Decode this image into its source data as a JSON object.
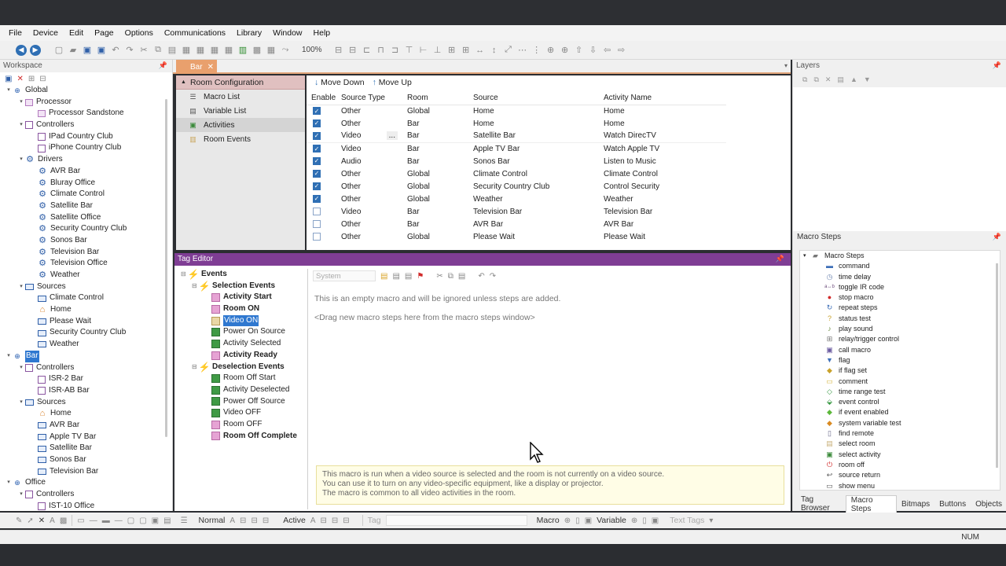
{
  "menu": [
    "File",
    "Device",
    "Edit",
    "Page",
    "Options",
    "Communications",
    "Library",
    "Window",
    "Help"
  ],
  "toolbar": {
    "zoom": "100%"
  },
  "workspace": {
    "title": "Workspace",
    "tree": [
      {
        "lvl": 0,
        "tog": "▾",
        "icon": "globe",
        "label": "Global"
      },
      {
        "lvl": 1,
        "tog": "▾",
        "icon": "proc",
        "label": "Processor"
      },
      {
        "lvl": 2,
        "tog": "",
        "icon": "proc",
        "label": "Processor Sandstone"
      },
      {
        "lvl": 1,
        "tog": "▾",
        "icon": "ctrl",
        "label": "Controllers"
      },
      {
        "lvl": 2,
        "tog": "",
        "icon": "ctrl",
        "label": "IPad Country Club"
      },
      {
        "lvl": 2,
        "tog": "",
        "icon": "ctrl",
        "label": "iPhone Country Club"
      },
      {
        "lvl": 1,
        "tog": "▾",
        "icon": "gear",
        "label": "Drivers"
      },
      {
        "lvl": 2,
        "tog": "",
        "icon": "gear",
        "label": "AVR Bar"
      },
      {
        "lvl": 2,
        "tog": "",
        "icon": "gear",
        "label": "Bluray Office"
      },
      {
        "lvl": 2,
        "tog": "",
        "icon": "gear",
        "label": "Climate Control"
      },
      {
        "lvl": 2,
        "tog": "",
        "icon": "gear",
        "label": "Satellite Bar"
      },
      {
        "lvl": 2,
        "tog": "",
        "icon": "gear",
        "label": "Satellite Office"
      },
      {
        "lvl": 2,
        "tog": "",
        "icon": "gear",
        "label": "Security Country Club"
      },
      {
        "lvl": 2,
        "tog": "",
        "icon": "gear",
        "label": "Sonos Bar"
      },
      {
        "lvl": 2,
        "tog": "",
        "icon": "gear",
        "label": "Television Bar"
      },
      {
        "lvl": 2,
        "tog": "",
        "icon": "gear",
        "label": "Television Office"
      },
      {
        "lvl": 2,
        "tog": "",
        "icon": "gear",
        "label": "Weather"
      },
      {
        "lvl": 1,
        "tog": "▾",
        "icon": "src",
        "label": "Sources"
      },
      {
        "lvl": 2,
        "tog": "",
        "icon": "src",
        "label": "Climate Control"
      },
      {
        "lvl": 2,
        "tog": "",
        "icon": "home",
        "label": "Home"
      },
      {
        "lvl": 2,
        "tog": "",
        "icon": "src",
        "label": "Please Wait"
      },
      {
        "lvl": 2,
        "tog": "",
        "icon": "src",
        "label": "Security Country Club"
      },
      {
        "lvl": 2,
        "tog": "",
        "icon": "src",
        "label": "Weather"
      },
      {
        "lvl": 0,
        "tog": "▾",
        "icon": "globe",
        "label": "Bar",
        "selected": true
      },
      {
        "lvl": 1,
        "tog": "▾",
        "icon": "ctrl",
        "label": "Controllers"
      },
      {
        "lvl": 2,
        "tog": "",
        "icon": "ctrl",
        "label": "ISR-2 Bar"
      },
      {
        "lvl": 2,
        "tog": "",
        "icon": "ctrl",
        "label": "ISR-AB Bar"
      },
      {
        "lvl": 1,
        "tog": "▾",
        "icon": "src",
        "label": "Sources"
      },
      {
        "lvl": 2,
        "tog": "",
        "icon": "home",
        "label": "Home"
      },
      {
        "lvl": 2,
        "tog": "",
        "icon": "src",
        "label": "AVR Bar"
      },
      {
        "lvl": 2,
        "tog": "",
        "icon": "src",
        "label": "Apple TV Bar"
      },
      {
        "lvl": 2,
        "tog": "",
        "icon": "src",
        "label": "Satellite Bar"
      },
      {
        "lvl": 2,
        "tog": "",
        "icon": "src",
        "label": "Sonos Bar"
      },
      {
        "lvl": 2,
        "tog": "",
        "icon": "src",
        "label": "Television Bar"
      },
      {
        "lvl": 0,
        "tog": "▾",
        "icon": "globe",
        "label": "Office"
      },
      {
        "lvl": 1,
        "tog": "▾",
        "icon": "ctrl",
        "label": "Controllers"
      },
      {
        "lvl": 2,
        "tog": "",
        "icon": "ctrl",
        "label": "IST-10 Office"
      }
    ]
  },
  "doctab": {
    "label": "Bar"
  },
  "roomconfig": {
    "header": "Room Configuration",
    "items": [
      {
        "label": "Macro List",
        "icon": "☰"
      },
      {
        "label": "Variable List",
        "icon": "▤"
      },
      {
        "label": "Activities",
        "icon": "▣",
        "active": true
      },
      {
        "label": "Room Events",
        "icon": "▥"
      }
    ]
  },
  "grid": {
    "move_down": "Move Down",
    "move_up": "Move Up",
    "columns": [
      "Enable",
      "Source Type",
      "Room",
      "Source",
      "Activity Name"
    ],
    "rows": [
      {
        "enabled": true,
        "type": "Other",
        "room": "Global",
        "source": "Home",
        "activity": "Home"
      },
      {
        "enabled": true,
        "type": "Other",
        "room": "Bar",
        "source": "Home",
        "activity": "Home"
      },
      {
        "enabled": true,
        "type": "Video",
        "room": "Bar",
        "source": "Satellite Bar",
        "activity": "Watch DirecTV",
        "ellipsis": "..."
      },
      {
        "enabled": true,
        "type": "Video",
        "room": "Bar",
        "source": "Apple TV Bar",
        "activity": "Watch Apple TV"
      },
      {
        "enabled": true,
        "type": "Audio",
        "room": "Bar",
        "source": "Sonos Bar",
        "activity": "Listen to Music"
      },
      {
        "enabled": true,
        "type": "Other",
        "room": "Global",
        "source": "Climate Control",
        "activity": "Climate Control"
      },
      {
        "enabled": true,
        "type": "Other",
        "room": "Global",
        "source": "Security Country Club",
        "activity": "Control Security"
      },
      {
        "enabled": true,
        "type": "Other",
        "room": "Global",
        "source": "Weather",
        "activity": "Weather"
      },
      {
        "enabled": false,
        "type": "Video",
        "room": "Bar",
        "source": "Television Bar",
        "activity": "Television Bar"
      },
      {
        "enabled": false,
        "type": "Other",
        "room": "Bar",
        "source": "AVR Bar",
        "activity": "AVR Bar"
      },
      {
        "enabled": false,
        "type": "Other",
        "room": "Global",
        "source": "Please Wait",
        "activity": "Please Wait"
      }
    ]
  },
  "layers": {
    "title": "Layers"
  },
  "tageditor": {
    "title": "Tag Editor",
    "events": [
      {
        "lvl": 0,
        "tog": "⊟",
        "icon": "lt",
        "label": "Events",
        "bold": true
      },
      {
        "lvl": 1,
        "tog": "⊟",
        "icon": "lt",
        "label": "Selection Events",
        "bold": true
      },
      {
        "lvl": 2,
        "tog": "",
        "icon": "pink",
        "label": "Activity Start",
        "bold": true
      },
      {
        "lvl": 2,
        "tog": "",
        "icon": "pink",
        "label": "Room ON",
        "bold": true
      },
      {
        "lvl": 2,
        "tog": "",
        "icon": "tan",
        "label": "Video ON",
        "selected": true
      },
      {
        "lvl": 2,
        "tog": "",
        "icon": "green",
        "label": "Power On Source"
      },
      {
        "lvl": 2,
        "tog": "",
        "icon": "green",
        "label": "Activity Selected"
      },
      {
        "lvl": 2,
        "tog": "",
        "icon": "pink",
        "label": "Activity Ready",
        "bold": true
      },
      {
        "lvl": 1,
        "tog": "⊟",
        "icon": "lt",
        "label": "Deselection Events",
        "bold": true
      },
      {
        "lvl": 2,
        "tog": "",
        "icon": "green",
        "label": "Room Off Start"
      },
      {
        "lvl": 2,
        "tog": "",
        "icon": "green",
        "label": "Activity Deselected"
      },
      {
        "lvl": 2,
        "tog": "",
        "icon": "green",
        "label": "Power Off Source"
      },
      {
        "lvl": 2,
        "tog": "",
        "icon": "green",
        "label": "Video OFF"
      },
      {
        "lvl": 2,
        "tog": "",
        "icon": "pink",
        "label": "Room OFF"
      },
      {
        "lvl": 2,
        "tog": "",
        "icon": "pink",
        "label": "Room Off Complete",
        "bold": true
      }
    ],
    "system": "System",
    "empty_msg": "This is an empty macro and will be ignored unless steps are added.",
    "drag_msg": "<Drag new macro steps here from the macro steps window>",
    "note_lines": [
      "This macro is run when a video source is selected and the room is not currently on a video source.",
      "You can use it to turn on any video-specific equipment, like a display or projector.",
      "The macro is common to all video activities in the room."
    ]
  },
  "macrosteps": {
    "title": "Macro Steps",
    "root": "Macro Steps",
    "items": [
      {
        "label": "command",
        "icon": "▬",
        "color": "#3d6fb8"
      },
      {
        "label": "time delay",
        "icon": "◷",
        "color": "#6f86b0"
      },
      {
        "label": "toggle IR code",
        "icon": "a↔b",
        "color": "#6a4a7a"
      },
      {
        "label": "stop macro",
        "icon": "●",
        "color": "#d12a2a"
      },
      {
        "label": "repeat steps",
        "icon": "↻",
        "color": "#3d6fb8"
      },
      {
        "label": "status test",
        "icon": "?",
        "color": "#c9a22c"
      },
      {
        "label": "play sound",
        "icon": "♪",
        "color": "#6a8a40"
      },
      {
        "label": "relay/trigger control",
        "icon": "⊞",
        "color": "#777"
      },
      {
        "label": "call macro",
        "icon": "▣",
        "color": "#6a5aa0"
      },
      {
        "label": "flag",
        "icon": "▼",
        "color": "#3d6fb8"
      },
      {
        "label": "if flag set",
        "icon": "◆",
        "color": "#c9a22c"
      },
      {
        "label": "comment",
        "icon": "▭",
        "color": "#d6b84a"
      },
      {
        "label": "time range test",
        "icon": "◇",
        "color": "#3a9a45"
      },
      {
        "label": "event control",
        "icon": "⬙",
        "color": "#3a9a45"
      },
      {
        "label": "if event enabled",
        "icon": "◆",
        "color": "#5cb83a"
      },
      {
        "label": "system variable test",
        "icon": "◆",
        "color": "#d98a22"
      },
      {
        "label": "find remote",
        "icon": "▯",
        "color": "#6a6a8a"
      },
      {
        "label": "select room",
        "icon": "▤",
        "color": "#c9b07a"
      },
      {
        "label": "select activity",
        "icon": "▣",
        "color": "#3a8a3a"
      },
      {
        "label": "room off",
        "icon": "⏻",
        "color": "#d12a2a"
      },
      {
        "label": "source return",
        "icon": "↩",
        "color": "#555"
      },
      {
        "label": "show menu",
        "icon": "▭",
        "color": "#555"
      }
    ],
    "tabs": [
      "Tag Browser",
      "Macro Steps",
      "Bitmaps",
      "Buttons",
      "Objects"
    ],
    "active_tab": "Macro Steps"
  },
  "bottombar": {
    "normal": "Normal",
    "active": "Active",
    "tag": "Tag",
    "macro": "Macro",
    "variable": "Variable",
    "text_tags": "Text Tags"
  },
  "status": {
    "num": "NUM"
  }
}
